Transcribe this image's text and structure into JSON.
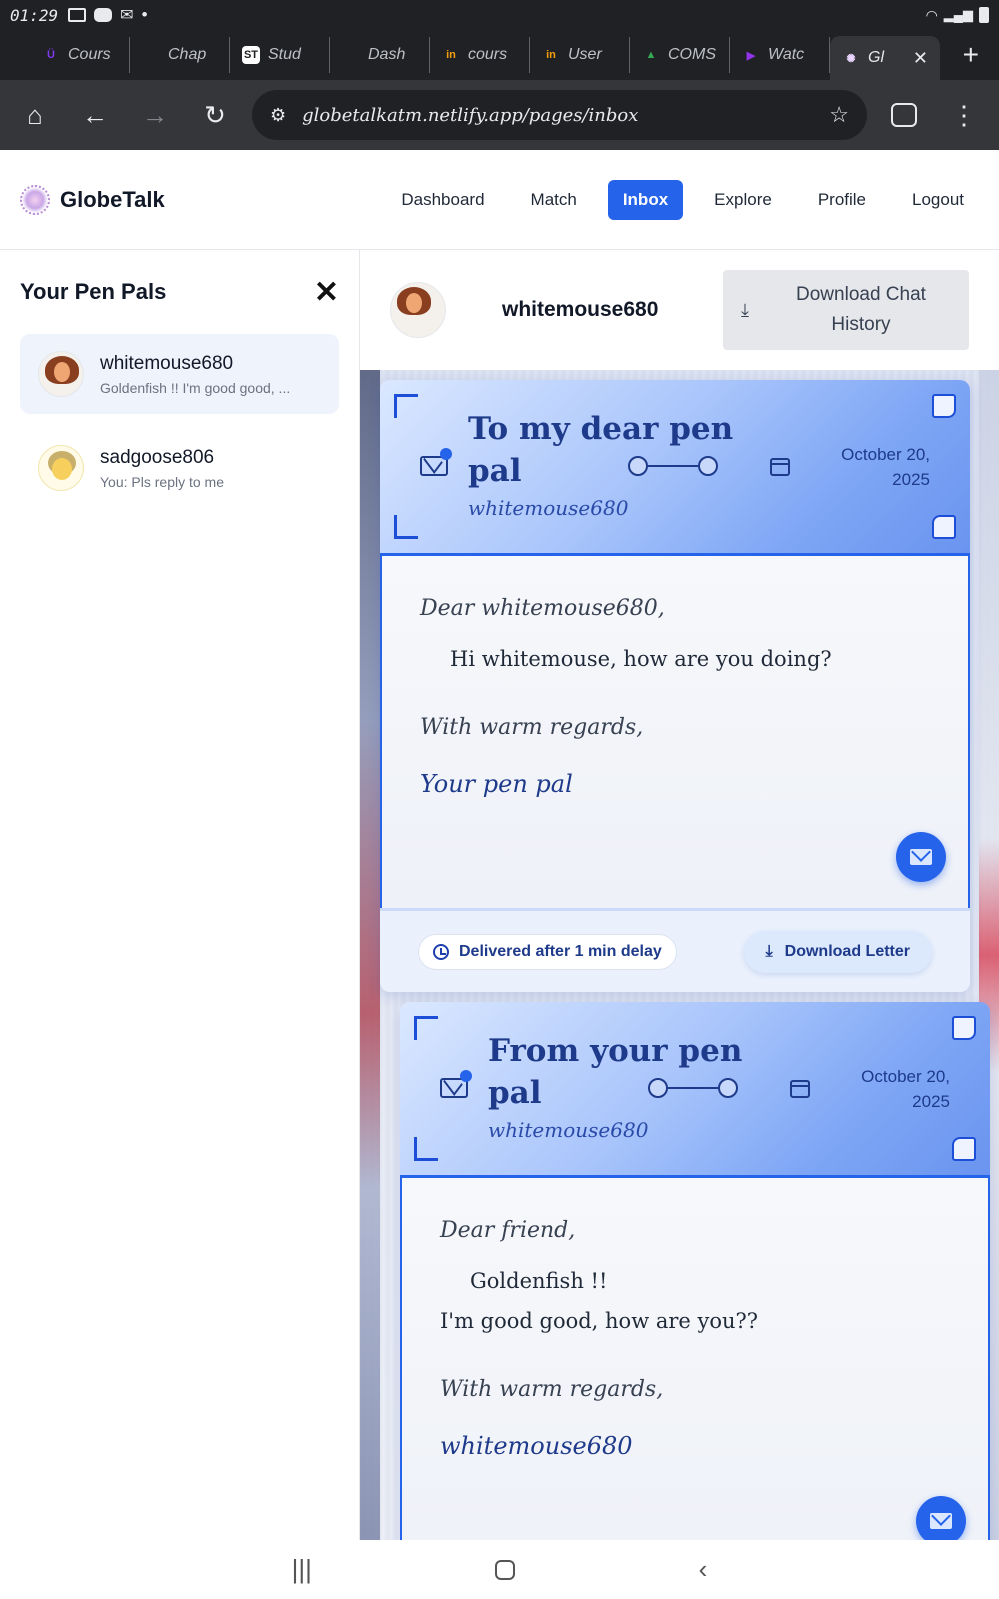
{
  "status_bar": {
    "time": "01:29"
  },
  "browser": {
    "tabs": [
      {
        "label": "Cours",
        "favicon": "udemy-icon",
        "color": "#7c3aed",
        "glyph": "Ü"
      },
      {
        "label": "Chap",
        "favicon": "blue-dot-icon",
        "color": "#1e3a8a",
        "glyph": ""
      },
      {
        "label": "Stud",
        "favicon": "st-icon",
        "color": "#ffffff",
        "glyph": "ST"
      },
      {
        "label": "Dash",
        "favicon": "globe-icon",
        "color": "#9aa0a6",
        "glyph": ""
      },
      {
        "label": "cours",
        "favicon": "in-icon",
        "color": "#f59e0b",
        "glyph": "in"
      },
      {
        "label": "User",
        "favicon": "in-icon",
        "color": "#f59e0b",
        "glyph": "in"
      },
      {
        "label": "COMS",
        "favicon": "drive-icon",
        "color": "#34a853",
        "glyph": "▲"
      },
      {
        "label": "Watc",
        "favicon": "play-icon",
        "color": "#9333ea",
        "glyph": "▶"
      },
      {
        "label": "Gl",
        "favicon": "globetalk-icon",
        "color": "#e9d5ff",
        "glyph": "✺",
        "active": true
      }
    ],
    "url": "globetalkatm.netlify.app/pages/inbox"
  },
  "app": {
    "brand": "GlobeTalk",
    "nav": [
      {
        "label": "Dashboard"
      },
      {
        "label": "Match"
      },
      {
        "label": "Inbox",
        "active": true
      },
      {
        "label": "Explore"
      },
      {
        "label": "Profile"
      },
      {
        "label": "Logout"
      }
    ]
  },
  "sidebar": {
    "title": "Your Pen Pals",
    "pals": [
      {
        "name": "whitemouse680",
        "preview": "Goldenfish !! I'm good good, ...",
        "selected": true
      },
      {
        "name": "sadgoose806",
        "preview": "You: Pls reply to me",
        "selected": false
      }
    ]
  },
  "chat": {
    "name": "whitemouse680",
    "download_chat": "Download Chat History",
    "letters": [
      {
        "title": "To my dear pen pal",
        "subtitle_sig": "whitemouse680",
        "date": "October 20, 2025",
        "salutation": "Dear whitemouse680,",
        "body": "Hi whitemouse, how are you doing?",
        "closing": "With warm regards,",
        "signature": "Your pen pal",
        "delivered": "Delivered after 1 min delay",
        "download": "Download Letter"
      },
      {
        "title": "From your pen pal",
        "subtitle_sig": "whitemouse680",
        "date": "October 20, 2025",
        "salutation": "Dear friend,",
        "body_line1": "Goldenfish !!",
        "body_line2": "I'm good good, how are you??",
        "closing": "With warm regards,",
        "signature": "whitemouse680"
      }
    ]
  },
  "colors": {
    "primary": "#2563eb",
    "navy": "#1e3a8a"
  }
}
